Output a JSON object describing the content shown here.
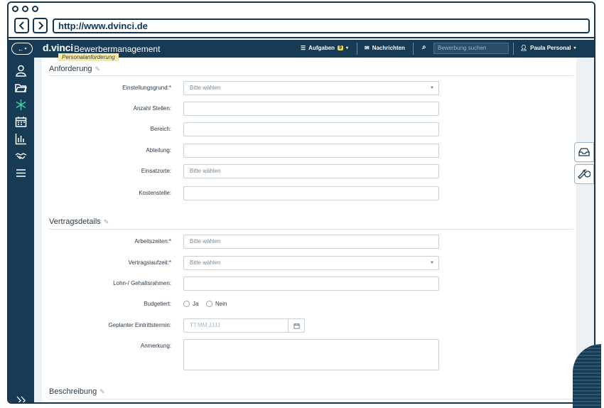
{
  "browser": {
    "url": "http://www.dvinci.de"
  },
  "topbar": {
    "brand": "d.vinci",
    "brand_sub": "Bewerbermanagement",
    "tasks_label": "Aufgaben",
    "tasks_count": "9",
    "messages_label": "Nachrichten",
    "search_placeholder": "Bewerbung suchen",
    "user_name": "Paula Personal"
  },
  "sidebar": {
    "icons": [
      "person-icon",
      "folder-icon",
      "asterisk-icon",
      "calendar-icon",
      "bar-chart-icon",
      "handshake-icon",
      "menu-icon",
      "expand-icon"
    ]
  },
  "tooltip": "Personalanforderung",
  "sections": {
    "anforderung": {
      "title": "Anforderung",
      "fields": [
        {
          "label": "Einstellungsgrund:*",
          "value": "Bitte wählen",
          "type": "select"
        },
        {
          "label": "Anzahl Stellen:",
          "value": "",
          "type": "text"
        },
        {
          "label": "Bereich:",
          "value": "",
          "type": "text"
        },
        {
          "label": "Abteilung:",
          "value": "",
          "type": "text"
        },
        {
          "label": "Einsatzorte:",
          "value": "Bitte wählen",
          "type": "text"
        },
        {
          "label": "Kostenstelle:",
          "value": "",
          "type": "text"
        }
      ]
    },
    "vertrag": {
      "title": "Vertragsdetails",
      "fields": [
        {
          "label": "Arbeitszeiten:*",
          "value": "Bitte wählen"
        },
        {
          "label": "Vertragslaufzeit:*",
          "value": "Bitte wählen"
        },
        {
          "label": "Lohn-/ Gehaltsrahmen:",
          "value": ""
        },
        {
          "label": "Budgetiert:",
          "option_yes": "Ja",
          "option_no": "Nein"
        },
        {
          "label": "Geplanter Eintrittstermin:",
          "placeholder": "TT.MM.JJJJ"
        },
        {
          "label": "Anmerkung:",
          "value": ""
        }
      ]
    },
    "beschreibung": {
      "title": "Beschreibung"
    }
  },
  "colors": {
    "navy": "#173a55",
    "badge": "#f2d94e",
    "tooltip": "#f7e9a3"
  }
}
